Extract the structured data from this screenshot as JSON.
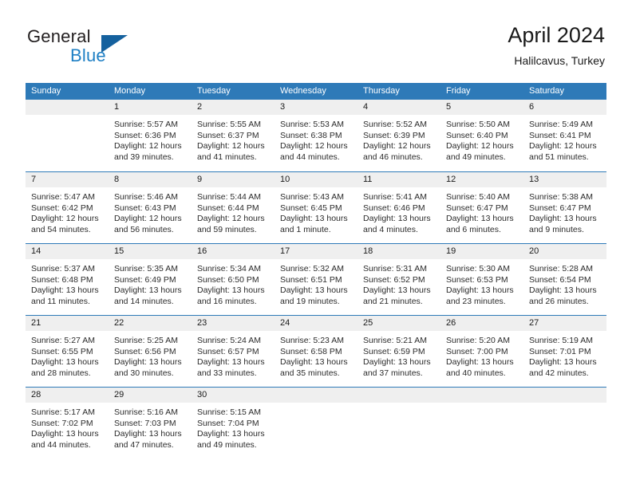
{
  "brand": {
    "name_part1": "General",
    "name_part2": "Blue",
    "triangle_color": "#15619e",
    "blue_color": "#1e7fc4"
  },
  "header": {
    "title": "April 2024",
    "subtitle": "Halilcavus, Turkey"
  },
  "theme": {
    "header_blue": "#2e7ab8",
    "day_band_gray": "#efefef",
    "text_color": "#2b2b2b"
  },
  "weekdays": [
    "Sunday",
    "Monday",
    "Tuesday",
    "Wednesday",
    "Thursday",
    "Friday",
    "Saturday"
  ],
  "weeks": [
    [
      {
        "day": "",
        "lines": []
      },
      {
        "day": "1",
        "lines": [
          "Sunrise: 5:57 AM",
          "Sunset: 6:36 PM",
          "Daylight: 12 hours",
          "and 39 minutes."
        ]
      },
      {
        "day": "2",
        "lines": [
          "Sunrise: 5:55 AM",
          "Sunset: 6:37 PM",
          "Daylight: 12 hours",
          "and 41 minutes."
        ]
      },
      {
        "day": "3",
        "lines": [
          "Sunrise: 5:53 AM",
          "Sunset: 6:38 PM",
          "Daylight: 12 hours",
          "and 44 minutes."
        ]
      },
      {
        "day": "4",
        "lines": [
          "Sunrise: 5:52 AM",
          "Sunset: 6:39 PM",
          "Daylight: 12 hours",
          "and 46 minutes."
        ]
      },
      {
        "day": "5",
        "lines": [
          "Sunrise: 5:50 AM",
          "Sunset: 6:40 PM",
          "Daylight: 12 hours",
          "and 49 minutes."
        ]
      },
      {
        "day": "6",
        "lines": [
          "Sunrise: 5:49 AM",
          "Sunset: 6:41 PM",
          "Daylight: 12 hours",
          "and 51 minutes."
        ]
      }
    ],
    [
      {
        "day": "7",
        "lines": [
          "Sunrise: 5:47 AM",
          "Sunset: 6:42 PM",
          "Daylight: 12 hours",
          "and 54 minutes."
        ]
      },
      {
        "day": "8",
        "lines": [
          "Sunrise: 5:46 AM",
          "Sunset: 6:43 PM",
          "Daylight: 12 hours",
          "and 56 minutes."
        ]
      },
      {
        "day": "9",
        "lines": [
          "Sunrise: 5:44 AM",
          "Sunset: 6:44 PM",
          "Daylight: 12 hours",
          "and 59 minutes."
        ]
      },
      {
        "day": "10",
        "lines": [
          "Sunrise: 5:43 AM",
          "Sunset: 6:45 PM",
          "Daylight: 13 hours",
          "and 1 minute."
        ]
      },
      {
        "day": "11",
        "lines": [
          "Sunrise: 5:41 AM",
          "Sunset: 6:46 PM",
          "Daylight: 13 hours",
          "and 4 minutes."
        ]
      },
      {
        "day": "12",
        "lines": [
          "Sunrise: 5:40 AM",
          "Sunset: 6:47 PM",
          "Daylight: 13 hours",
          "and 6 minutes."
        ]
      },
      {
        "day": "13",
        "lines": [
          "Sunrise: 5:38 AM",
          "Sunset: 6:47 PM",
          "Daylight: 13 hours",
          "and 9 minutes."
        ]
      }
    ],
    [
      {
        "day": "14",
        "lines": [
          "Sunrise: 5:37 AM",
          "Sunset: 6:48 PM",
          "Daylight: 13 hours",
          "and 11 minutes."
        ]
      },
      {
        "day": "15",
        "lines": [
          "Sunrise: 5:35 AM",
          "Sunset: 6:49 PM",
          "Daylight: 13 hours",
          "and 14 minutes."
        ]
      },
      {
        "day": "16",
        "lines": [
          "Sunrise: 5:34 AM",
          "Sunset: 6:50 PM",
          "Daylight: 13 hours",
          "and 16 minutes."
        ]
      },
      {
        "day": "17",
        "lines": [
          "Sunrise: 5:32 AM",
          "Sunset: 6:51 PM",
          "Daylight: 13 hours",
          "and 19 minutes."
        ]
      },
      {
        "day": "18",
        "lines": [
          "Sunrise: 5:31 AM",
          "Sunset: 6:52 PM",
          "Daylight: 13 hours",
          "and 21 minutes."
        ]
      },
      {
        "day": "19",
        "lines": [
          "Sunrise: 5:30 AM",
          "Sunset: 6:53 PM",
          "Daylight: 13 hours",
          "and 23 minutes."
        ]
      },
      {
        "day": "20",
        "lines": [
          "Sunrise: 5:28 AM",
          "Sunset: 6:54 PM",
          "Daylight: 13 hours",
          "and 26 minutes."
        ]
      }
    ],
    [
      {
        "day": "21",
        "lines": [
          "Sunrise: 5:27 AM",
          "Sunset: 6:55 PM",
          "Daylight: 13 hours",
          "and 28 minutes."
        ]
      },
      {
        "day": "22",
        "lines": [
          "Sunrise: 5:25 AM",
          "Sunset: 6:56 PM",
          "Daylight: 13 hours",
          "and 30 minutes."
        ]
      },
      {
        "day": "23",
        "lines": [
          "Sunrise: 5:24 AM",
          "Sunset: 6:57 PM",
          "Daylight: 13 hours",
          "and 33 minutes."
        ]
      },
      {
        "day": "24",
        "lines": [
          "Sunrise: 5:23 AM",
          "Sunset: 6:58 PM",
          "Daylight: 13 hours",
          "and 35 minutes."
        ]
      },
      {
        "day": "25",
        "lines": [
          "Sunrise: 5:21 AM",
          "Sunset: 6:59 PM",
          "Daylight: 13 hours",
          "and 37 minutes."
        ]
      },
      {
        "day": "26",
        "lines": [
          "Sunrise: 5:20 AM",
          "Sunset: 7:00 PM",
          "Daylight: 13 hours",
          "and 40 minutes."
        ]
      },
      {
        "day": "27",
        "lines": [
          "Sunrise: 5:19 AM",
          "Sunset: 7:01 PM",
          "Daylight: 13 hours",
          "and 42 minutes."
        ]
      }
    ],
    [
      {
        "day": "28",
        "lines": [
          "Sunrise: 5:17 AM",
          "Sunset: 7:02 PM",
          "Daylight: 13 hours",
          "and 44 minutes."
        ]
      },
      {
        "day": "29",
        "lines": [
          "Sunrise: 5:16 AM",
          "Sunset: 7:03 PM",
          "Daylight: 13 hours",
          "and 47 minutes."
        ]
      },
      {
        "day": "30",
        "lines": [
          "Sunrise: 5:15 AM",
          "Sunset: 7:04 PM",
          "Daylight: 13 hours",
          "and 49 minutes."
        ]
      },
      {
        "day": "",
        "lines": []
      },
      {
        "day": "",
        "lines": []
      },
      {
        "day": "",
        "lines": []
      },
      {
        "day": "",
        "lines": []
      }
    ]
  ]
}
